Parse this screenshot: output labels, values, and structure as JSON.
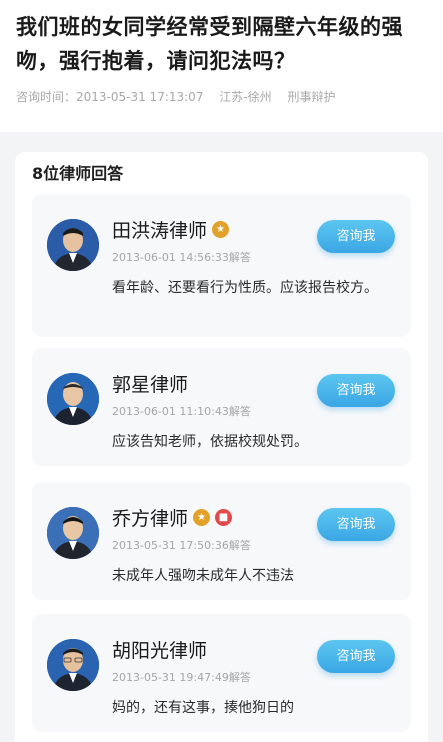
{
  "question": {
    "title": "我们班的女同学经常受到隔壁六年级的强吻，强行抱着，请问犯法吗？",
    "time": "咨询时间：2013-05-31 17:13:07",
    "location": "江苏-徐州",
    "category": "刑事辩护"
  },
  "answers": {
    "heading": "8位律师回答",
    "items": [
      {
        "name": "田洪涛律师",
        "time": "2013-06-01 14:56:33解答",
        "text": "看年龄、还要看行为性质。应该报告校方。",
        "button": "咨询我",
        "badges": [
          "gold-medal-icon"
        ]
      },
      {
        "name": "郭星律师",
        "time": "2013-06-01 11:10:43解答",
        "text": "应该告知老师，依据校规处罚。",
        "button": "咨询我",
        "badges": []
      },
      {
        "name": "乔方律师",
        "time": "2013-05-31 17:50:36解答",
        "text": "未成年人强吻未成年人不违法",
        "button": "咨询我",
        "badges": [
          "gold-medal-icon",
          "red-badge-icon"
        ]
      },
      {
        "name": "胡阳光律师",
        "time": "2013-05-31 19:47:49解答",
        "text": "妈的，还有这事，揍他狗日的",
        "button": "咨询我",
        "badges": []
      }
    ]
  },
  "colors": {
    "accent": "#3aa6e4",
    "badge_gold": "#e2a229",
    "badge_red": "#e04a4a"
  }
}
